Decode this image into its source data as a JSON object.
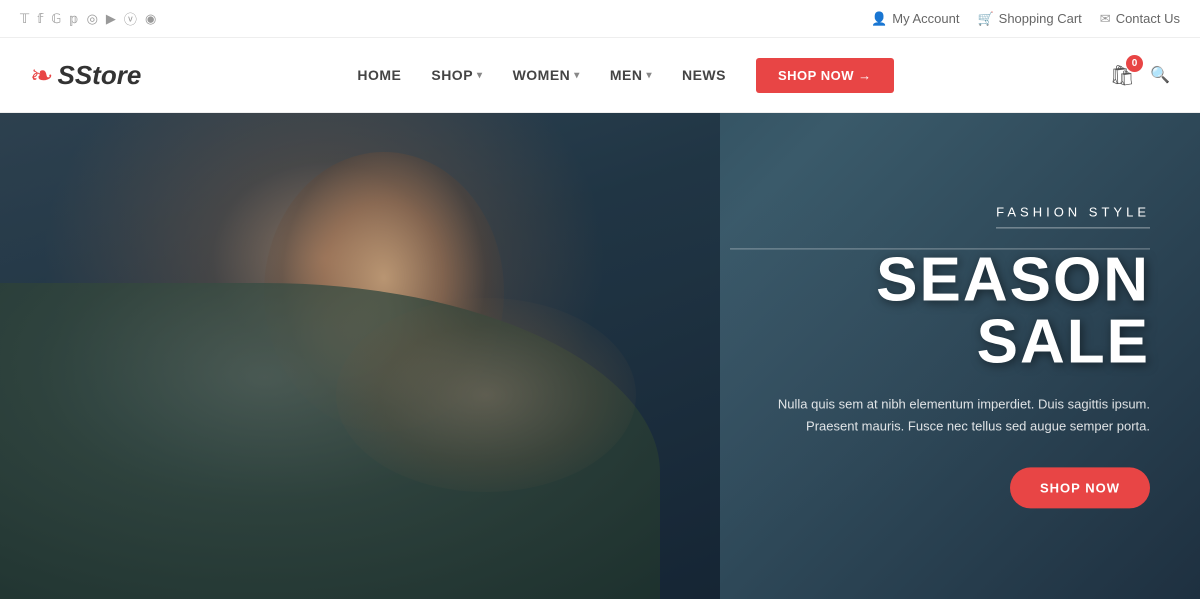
{
  "top_bar": {
    "social_links": [
      {
        "name": "twitter",
        "symbol": "𝕏",
        "label": "Twitter"
      },
      {
        "name": "facebook",
        "symbol": "f",
        "label": "Facebook"
      },
      {
        "name": "google-plus",
        "symbol": "G+",
        "label": "Google Plus"
      },
      {
        "name": "pinterest",
        "symbol": "P",
        "label": "Pinterest"
      },
      {
        "name": "instagram",
        "symbol": "◎",
        "label": "Instagram"
      },
      {
        "name": "youtube",
        "symbol": "▶",
        "label": "YouTube"
      },
      {
        "name": "vimeo",
        "symbol": "V",
        "label": "Vimeo"
      },
      {
        "name": "rss",
        "symbol": "◉",
        "label": "RSS"
      }
    ],
    "links": [
      {
        "label": "My Account",
        "icon": "👤"
      },
      {
        "label": "Shopping Cart",
        "icon": "🛒"
      },
      {
        "label": "Contact Us",
        "icon": "✉"
      }
    ]
  },
  "header": {
    "logo_text": "Store",
    "nav_items": [
      {
        "label": "HOME",
        "has_dropdown": false
      },
      {
        "label": "SHOP",
        "has_dropdown": true
      },
      {
        "label": "WOMEN",
        "has_dropdown": true
      },
      {
        "label": "MEN",
        "has_dropdown": true
      },
      {
        "label": "NEWS",
        "has_dropdown": false
      }
    ],
    "shop_now_button": "SHOP NOW →",
    "cart_count": "0"
  },
  "hero": {
    "subtitle": "FASHION STYLE",
    "title": "SEASON SALE",
    "description_line1": "Nulla quis sem at nibh elementum imperdiet. Duis sagittis ipsum.",
    "description_line2": "Praesent mauris. Fusce nec tellus sed augue semper porta.",
    "button_label": "SHOP NOW",
    "accent_color": "#e84545"
  }
}
